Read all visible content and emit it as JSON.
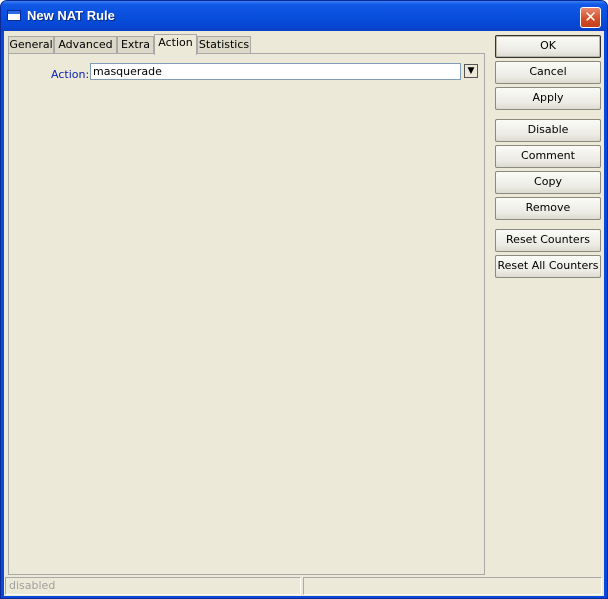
{
  "window": {
    "title": "New NAT Rule",
    "close_glyph": "✕"
  },
  "tabs": [
    {
      "label": "General",
      "active": false
    },
    {
      "label": "Advanced",
      "active": false
    },
    {
      "label": "Extra",
      "active": false
    },
    {
      "label": "Action",
      "active": true
    },
    {
      "label": "Statistics",
      "active": false
    }
  ],
  "action": {
    "label": "Action:",
    "value": "masquerade",
    "dropdown_glyph": "▼"
  },
  "buttons": {
    "ok": "OK",
    "cancel": "Cancel",
    "apply": "Apply",
    "disable": "Disable",
    "comment": "Comment",
    "copy": "Copy",
    "remove": "Remove",
    "reset_counters": "Reset Counters",
    "reset_all_counters": "Reset All Counters"
  },
  "status": {
    "left": "disabled",
    "right": ""
  },
  "colors": {
    "titlebar": "#0a4fde",
    "client_bg": "#ece9d8",
    "label_blue": "#0b1fb0"
  }
}
